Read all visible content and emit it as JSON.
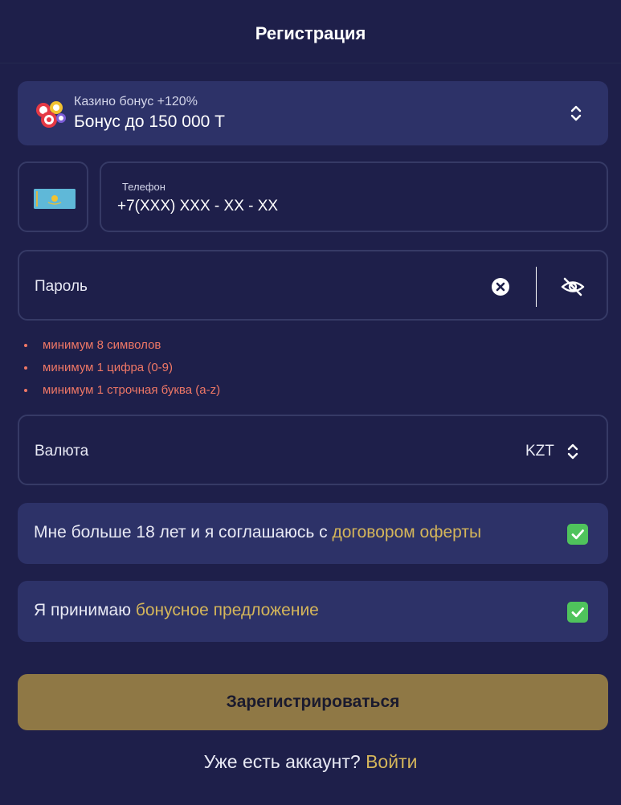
{
  "header": {
    "title": "Регистрация"
  },
  "bonus": {
    "icon": "casino-chips-icon",
    "subtitle": "Казино бонус +120%",
    "value": "Бонус до 150 000 T"
  },
  "phone": {
    "flag": "kazakhstan-flag-icon",
    "label": "Телефон",
    "placeholder": "+7(XXX) XXX - XX - XX"
  },
  "password": {
    "placeholder": "Пароль",
    "rules": [
      "минимум 8 символов",
      "минимум 1 цифра (0-9)",
      "минимум 1 строчная буква (a-z)"
    ]
  },
  "currency": {
    "label": "Валюта",
    "value": "KZT"
  },
  "consents": {
    "age_text": "Мне больше 18 лет и я соглашаюсь с ",
    "age_link": "договором оферты",
    "age_checked": true,
    "bonus_text": "Я принимаю ",
    "bonus_link": "бонусное предложение",
    "bonus_checked": true
  },
  "submit_label": "Зарегистрироваться",
  "footer": {
    "question": "Уже есть аккаунт? ",
    "login_link": "Войти"
  },
  "colors": {
    "background": "#1e1f4a",
    "card": "#2d3268",
    "accent": "#d4b55a",
    "button": "#8f7845",
    "error": "#f07866",
    "check": "#4fc35c"
  }
}
